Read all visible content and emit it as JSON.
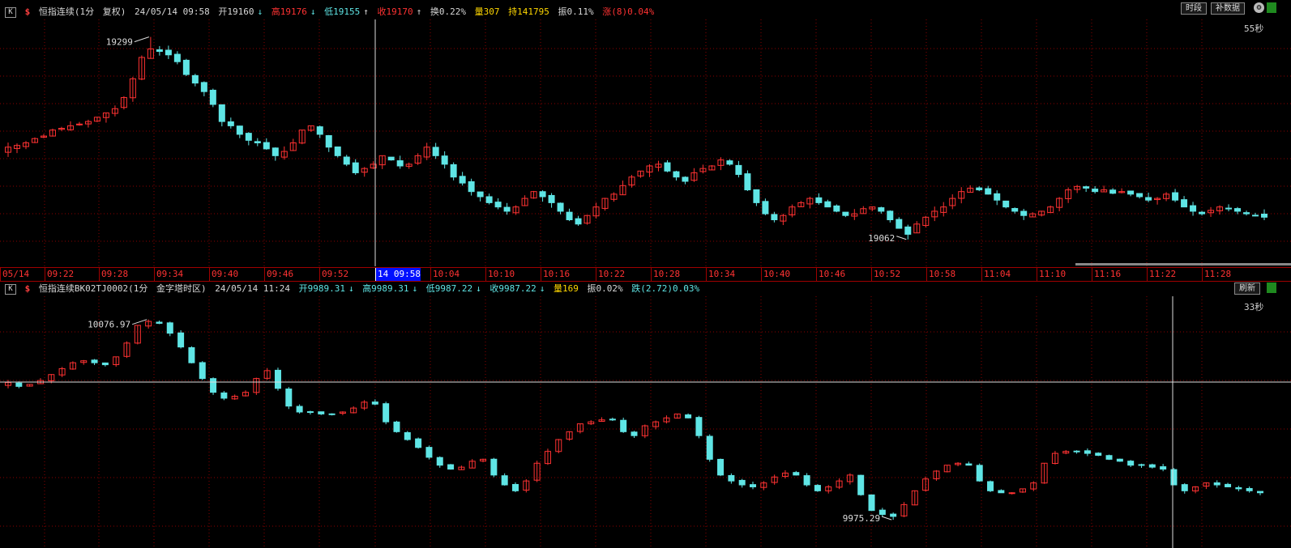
{
  "top": {
    "k_icon": "K",
    "dollar": "$",
    "title": "恒指连续(1分",
    "adjust": "复权)",
    "datetime": "24/05/14  09:58",
    "open": "开19160",
    "high": "高19176",
    "low": "低19155",
    "close": "收19170",
    "turnover": "换0.22%",
    "volume": "量307",
    "hold": "持141795",
    "amplitude": "振0.11%",
    "change": "涨(8)0.04%",
    "btn_period": "时段",
    "btn_data": "补数据",
    "seconds": "55秒",
    "max_label": "19299",
    "min_label": "19062"
  },
  "timebar": {
    "labels": [
      "05/14",
      "09:22",
      "09:28",
      "09:34",
      "09:40",
      "09:46",
      "09:52",
      "14  09:58",
      "10:04",
      "10:10",
      "10:16",
      "10:22",
      "10:28",
      "10:34",
      "10:40",
      "10:46",
      "10:52",
      "10:58",
      "11:04",
      "11:10",
      "11:16",
      "11:22",
      "11:28"
    ],
    "selected_index": 7
  },
  "bottom": {
    "k_icon": "K",
    "dollar": "$",
    "title": "恒指连续BK02TJ0002(1分",
    "formula": "金字塔时区)",
    "datetime": "24/05/14  11:24",
    "open": "开9989.31",
    "high": "高9989.31",
    "low": "低9987.22",
    "close": "收9987.22",
    "volume": "量169",
    "amplitude": "振0.02%",
    "change": "跌(2.72)0.03%",
    "btn_refresh": "刷新",
    "seconds": "33秒",
    "max_label": "10076.97",
    "min_label": "9975.29"
  },
  "colors": {
    "up": "#ff3232",
    "down": "#5fe5e5",
    "grid": "#8b0000",
    "text": "#c0c0c0"
  },
  "chart_data": [
    {
      "type": "candlestick",
      "title": "恒指连续(1分 复权)",
      "x_range": [
        "09:16",
        "11:33"
      ],
      "y_range": [
        19040,
        19310
      ],
      "annotated_high": 19299,
      "annotated_low": 19062,
      "close_path": [
        19170,
        19172,
        19175,
        19180,
        19183,
        19190,
        19192,
        19195,
        19197,
        19200,
        19205,
        19210,
        19215,
        19228,
        19250,
        19275,
        19285,
        19282,
        19278,
        19270,
        19255,
        19245,
        19235,
        19220,
        19200,
        19195,
        19185,
        19178,
        19175,
        19168,
        19160,
        19165,
        19175,
        19190,
        19195,
        19185,
        19170,
        19160,
        19150,
        19140,
        19145,
        19150,
        19160,
        19155,
        19148,
        19150,
        19160,
        19170,
        19160,
        19150,
        19135,
        19128,
        19118,
        19112,
        19105,
        19100,
        19095,
        19100,
        19110,
        19118,
        19112,
        19105,
        19095,
        19085,
        19080,
        19090,
        19100,
        19110,
        19115,
        19125,
        19135,
        19142,
        19148,
        19150,
        19142,
        19135,
        19130,
        19140,
        19145,
        19148,
        19155,
        19150,
        19138,
        19120,
        19105,
        19092,
        19085,
        19090,
        19100,
        19105,
        19110,
        19105,
        19100,
        19095,
        19090,
        19092,
        19098,
        19100,
        19095,
        19085,
        19075,
        19068,
        19080,
        19088,
        19095,
        19100,
        19110,
        19118,
        19122,
        19120,
        19115,
        19108,
        19100,
        19095,
        19090,
        19092,
        19095,
        19100,
        19110,
        19120,
        19124,
        19122,
        19118,
        19120,
        19116,
        19118,
        19115,
        19112,
        19108,
        19110,
        19115,
        19108,
        19100,
        19095,
        19092,
        19096,
        19100,
        19098,
        19095,
        19092,
        19090,
        19088
      ]
    },
    {
      "type": "candlestick",
      "title": "恒指连续BK02TJ0002(1分 金字塔时区)",
      "x_range": [
        "09:16",
        "11:24"
      ],
      "y_range": [
        9970,
        10083
      ],
      "annotated_high": 10076.97,
      "annotated_low": 9975.29,
      "close_path": [
        10045,
        10043,
        10044,
        10046,
        10049,
        10052,
        10055,
        10056,
        10055,
        10054,
        10058,
        10065,
        10074,
        10076,
        10075,
        10070,
        10063,
        10055,
        10047,
        10040,
        10037,
        10038,
        10040,
        10047,
        10051,
        10042,
        10033,
        10030,
        10030,
        10029,
        10029,
        10030,
        10032,
        10035,
        10034,
        10025,
        10020,
        10016,
        10012,
        10007,
        10003,
        10001,
        10002,
        10005,
        10006,
        9998,
        9993,
        9990,
        9995,
        10004,
        10010,
        10016,
        10020,
        10024,
        10025,
        10026,
        10026,
        10020,
        10018,
        10023,
        10025,
        10027,
        10029,
        10027,
        10018,
        10006,
        9998,
        9995,
        9993,
        9992,
        9994,
        9997,
        9999,
        9998,
        9993,
        9990,
        9992,
        9995,
        9998,
        9988,
        9980,
        9978,
        9977,
        9983,
        9990,
        9996,
        10000,
        10003,
        10004,
        10003,
        9995,
        9990,
        9989,
        9989,
        9991,
        9994,
        10004,
        10009,
        10010,
        10010,
        10009,
        10008,
        10006,
        10005,
        10003,
        10003,
        10002,
        10001,
        9993,
        9990,
        9992,
        9994,
        9993,
        9992,
        9991,
        9990,
        9989
      ]
    }
  ]
}
